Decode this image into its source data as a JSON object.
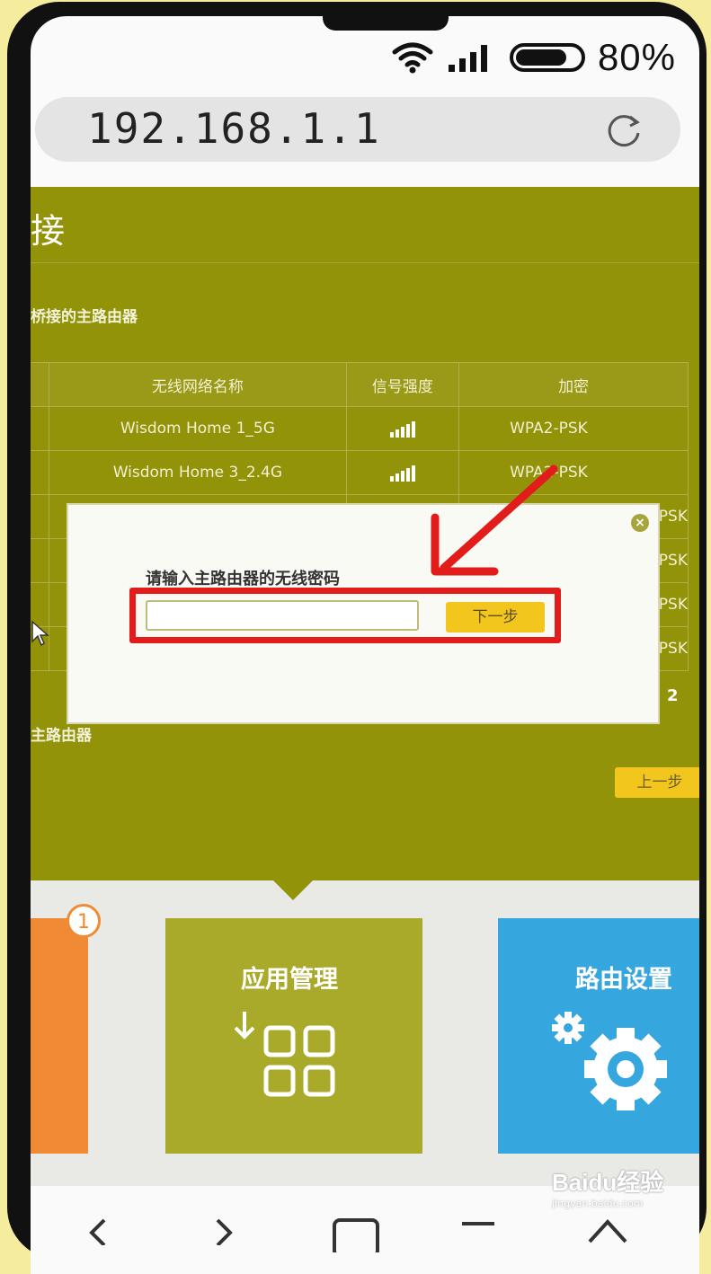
{
  "status_bar": {
    "battery_text": "80%",
    "battery_level": 0.8
  },
  "browser": {
    "url": "192.168.1.1"
  },
  "page": {
    "title_fragment": "接",
    "subtitle": "桥接的主路由器",
    "table": {
      "headers": [
        "",
        "无线网络名称",
        "信号强度",
        "加密"
      ],
      "rows": [
        {
          "name": "Wisdom Home 1_5G",
          "encryption": "WPA2-PSK"
        },
        {
          "name": "Wisdom Home 3_2.4G",
          "encryption": "WPA2-PSK"
        },
        {
          "name": "",
          "encryption": "PSK"
        },
        {
          "name": "",
          "encryption": "PSK"
        },
        {
          "name": "",
          "encryption": "PSK"
        },
        {
          "name": "",
          "encryption": "PSK"
        }
      ]
    },
    "pagination_page": "2",
    "subtitle2": "主路由器",
    "prev_button": "上一步"
  },
  "dialog": {
    "label": "请输入主路由器的无线密码",
    "password_value": "",
    "next_button": "下一步",
    "close_glyph": "×"
  },
  "tiles": {
    "badge_count": "1",
    "app_management": "应用管理",
    "router_settings": "路由设置"
  },
  "watermark": {
    "logo": "Baidu经验",
    "url": "jingyan.baidu.com"
  },
  "colors": {
    "olive": "#93930a",
    "highlight_red": "#e21b1b",
    "button_yellow": "#f3c61d",
    "tile_blue": "#36a6df",
    "tile_orange": "#f08a34"
  }
}
